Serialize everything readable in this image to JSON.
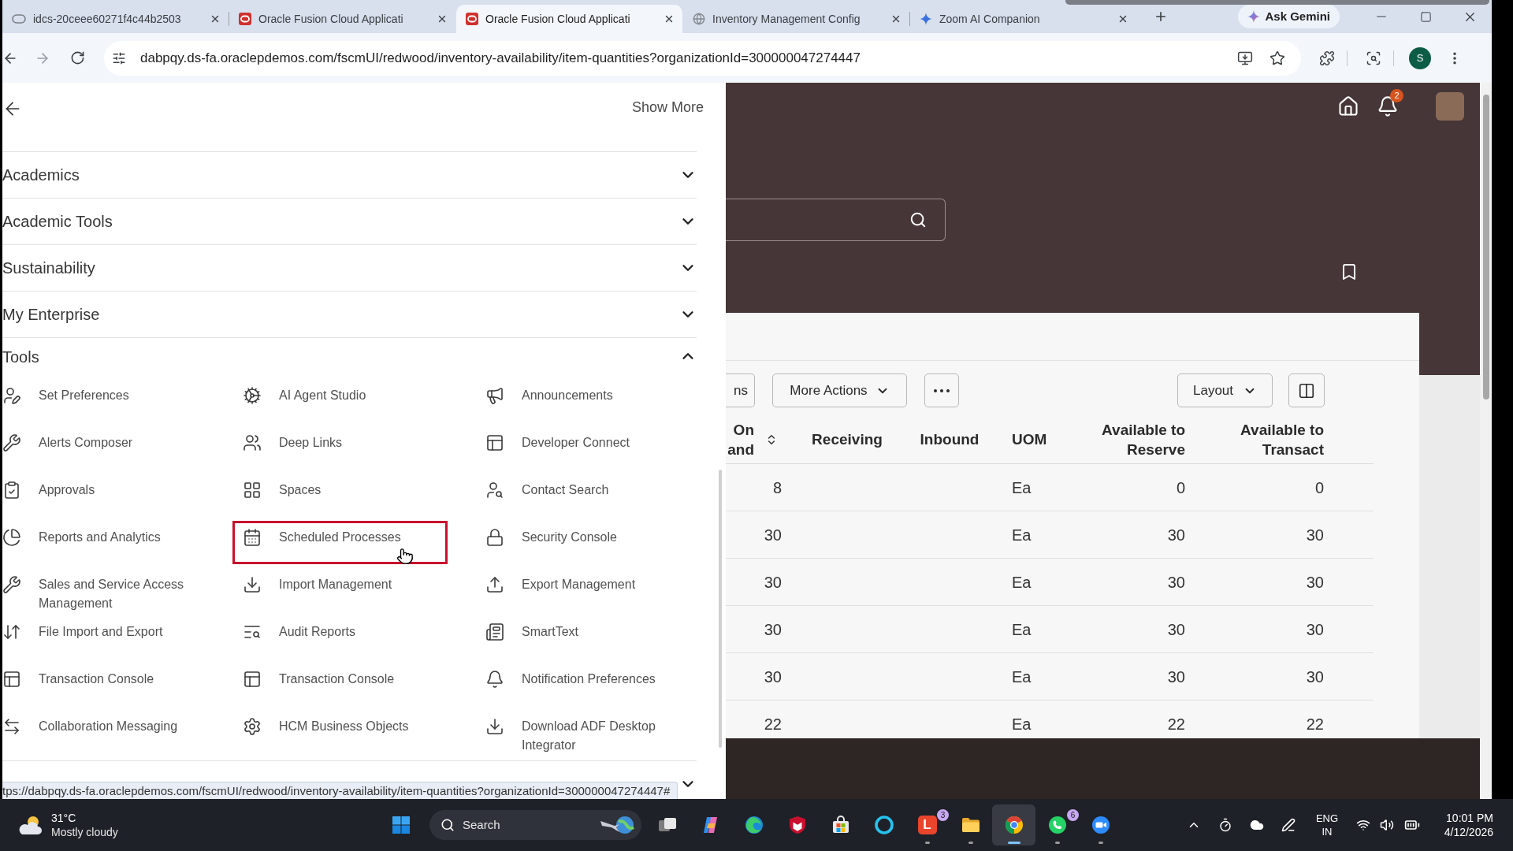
{
  "browser": {
    "tabs": [
      {
        "title": "idcs-20ceee60271f4c44b2503",
        "selected": false
      },
      {
        "title": "Oracle Fusion Cloud Applicati",
        "selected": false
      },
      {
        "title": "Oracle Fusion Cloud Applicati",
        "selected": true
      },
      {
        "title": "Inventory Management Config",
        "selected": false
      },
      {
        "title": "Zoom AI Companion",
        "selected": false
      }
    ],
    "gemini": "Ask Gemini",
    "url": "dabpqy.ds-fa.oraclepdemos.com/fscmUI/redwood/inventory-availability/item-quantities?organizationId=300000047274447",
    "profile": "S",
    "status_url": "tps://dabpqy.ds-fa.oraclepdemos.com/fscmUI/redwood/inventory-availability/item-quantities?organizationId=300000047274447#"
  },
  "menu": {
    "show_more": "Show More",
    "sections": [
      {
        "label": "Academics",
        "expanded": false
      },
      {
        "label": "Academic Tools",
        "expanded": false
      },
      {
        "label": "Sustainability",
        "expanded": false
      },
      {
        "label": "My Enterprise",
        "expanded": false
      },
      {
        "label": "Tools",
        "expanded": true,
        "items": [
          {
            "label": "Set Preferences",
            "highlighted": false
          },
          {
            "label": "AI Agent Studio",
            "highlighted": false
          },
          {
            "label": "Announcements",
            "highlighted": false
          },
          {
            "label": "Alerts Composer",
            "highlighted": false
          },
          {
            "label": "Deep Links",
            "highlighted": false
          },
          {
            "label": "Developer Connect",
            "highlighted": false
          },
          {
            "label": "Approvals",
            "highlighted": false
          },
          {
            "label": "Spaces",
            "highlighted": false
          },
          {
            "label": "Contact Search",
            "highlighted": false
          },
          {
            "label": "Reports and Analytics",
            "highlighted": false
          },
          {
            "label": "Scheduled Processes",
            "highlighted": true
          },
          {
            "label": "Security Console",
            "highlighted": false
          },
          {
            "label": "Sales and Service Access Management",
            "highlighted": false
          },
          {
            "label": "Import Management",
            "highlighted": false
          },
          {
            "label": "Export Management",
            "highlighted": false
          },
          {
            "label": "File Import and Export",
            "highlighted": false
          },
          {
            "label": "Audit Reports",
            "highlighted": false
          },
          {
            "label": "SmartText",
            "highlighted": false
          },
          {
            "label": "Transaction Console",
            "highlighted": false
          },
          {
            "label": "Transaction Console",
            "highlighted": false
          },
          {
            "label": "Notification Preferences",
            "highlighted": false
          },
          {
            "label": "Collaboration Messaging",
            "highlighted": false
          },
          {
            "label": "HCM Business Objects",
            "highlighted": false
          },
          {
            "label": "Download ADF Desktop Integrator",
            "highlighted": false
          }
        ]
      },
      {
        "expanded": false
      }
    ]
  },
  "header": {
    "notifications": "2"
  },
  "toolbar": {
    "partial_button": "ns",
    "more_actions": "More Actions",
    "layout": "Layout"
  },
  "table": {
    "columns": [
      {
        "label": "On and",
        "sortable": true
      },
      {
        "label": "Receiving",
        "sortable": false
      },
      {
        "label": "Inbound",
        "sortable": false
      },
      {
        "label": "UOM",
        "sortable": false
      },
      {
        "label": "Available to Reserve",
        "sortable": false
      },
      {
        "label": "Available to Transact",
        "sortable": false
      }
    ],
    "rows": [
      {
        "column_1": "8",
        "uom": "Ea",
        "available_to_reserve": "0",
        "available_to_transact": "0"
      },
      {
        "column_1": "30",
        "uom": "Ea",
        "available_to_reserve": "30",
        "available_to_transact": "30"
      },
      {
        "column_1": "30",
        "uom": "Ea",
        "available_to_reserve": "30",
        "available_to_transact": "30"
      },
      {
        "column_1": "30",
        "uom": "Ea",
        "available_to_reserve": "30",
        "available_to_transact": "30"
      },
      {
        "column_1": "30",
        "uom": "Ea",
        "available_to_reserve": "30",
        "available_to_transact": "30"
      },
      {
        "column_1": "22",
        "uom": "Ea",
        "available_to_reserve": "22",
        "available_to_transact": "22"
      }
    ]
  },
  "taskbar": {
    "weather": {
      "temperature": "31°C",
      "condition": "Mostly cloudy"
    },
    "search": "Search",
    "apps": [
      {
        "running": false,
        "selected": false
      },
      {
        "running": false,
        "selected": false
      },
      {
        "running": false,
        "selected": false
      },
      {
        "running": false,
        "selected": false
      },
      {
        "running": false,
        "selected": false
      },
      {
        "running": false,
        "selected": false
      },
      {
        "running": true,
        "selected": false,
        "badge": "3",
        "logo_text": "L"
      },
      {
        "running": true,
        "selected": false
      },
      {
        "running": true,
        "selected": true
      },
      {
        "running": true,
        "selected": false,
        "badge": "6"
      },
      {
        "running": true,
        "selected": false
      }
    ],
    "language": "ENG",
    "region": "IN",
    "time": "10:01 PM",
    "date": "4/12/2026"
  }
}
